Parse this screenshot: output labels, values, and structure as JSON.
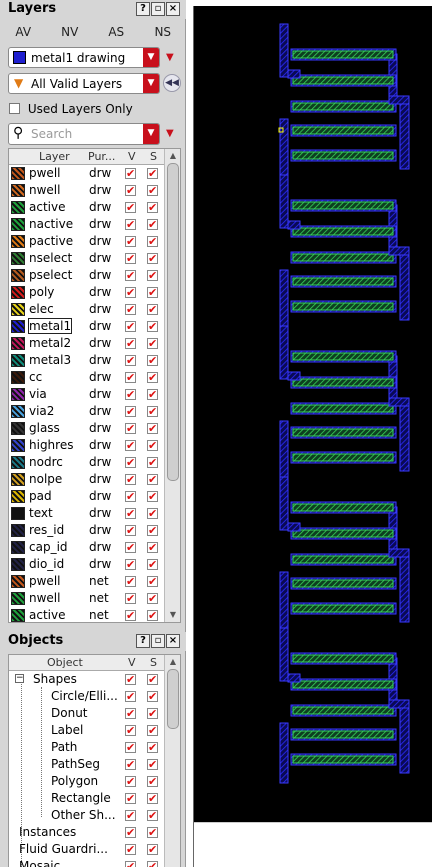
{
  "layers_panel": {
    "title": "Layers",
    "tabs": [
      "AV",
      "NV",
      "AS",
      "NS"
    ],
    "drawing_combo": "metal1 drawing",
    "filter_combo": "All Valid Layers",
    "used_only_label": "Used Layers Only",
    "search_placeholder": "Search",
    "columns": {
      "layer": "Layer",
      "purpose": "Pur...",
      "v": "V",
      "s": "S"
    },
    "rows": [
      {
        "name": "pwell",
        "purpose": "drw",
        "color": "#c4571b"
      },
      {
        "name": "nwell",
        "purpose": "drw",
        "color": "#d2691e"
      },
      {
        "name": "active",
        "purpose": "drw",
        "color": "#1fa03c"
      },
      {
        "name": "nactive",
        "purpose": "drw",
        "color": "#1fa03c"
      },
      {
        "name": "pactive",
        "purpose": "drw",
        "color": "#e07b16"
      },
      {
        "name": "nselect",
        "purpose": "drw",
        "color": "#2e7d32"
      },
      {
        "name": "pselect",
        "purpose": "drw",
        "color": "#b35a1f"
      },
      {
        "name": "poly",
        "purpose": "drw",
        "color": "#d81b1b"
      },
      {
        "name": "elec",
        "purpose": "drw",
        "color": "#e6d21a"
      },
      {
        "name": "metal1",
        "purpose": "drw",
        "color": "#1f1fcf",
        "selected": true
      },
      {
        "name": "metal2",
        "purpose": "drw",
        "color": "#c2185b"
      },
      {
        "name": "metal3",
        "purpose": "drw",
        "color": "#0f8c7a"
      },
      {
        "name": "cc",
        "purpose": "drw",
        "color": "#3a1a0a"
      },
      {
        "name": "via",
        "purpose": "drw",
        "color": "#8e24aa"
      },
      {
        "name": "via2",
        "purpose": "drw",
        "color": "#4aa3df"
      },
      {
        "name": "glass",
        "purpose": "drw",
        "color": "#333333"
      },
      {
        "name": "highres",
        "purpose": "drw",
        "color": "#3344cc"
      },
      {
        "name": "nodrc",
        "purpose": "drw",
        "color": "#1a7a8a"
      },
      {
        "name": "nolpe",
        "purpose": "drw",
        "color": "#d2a020"
      },
      {
        "name": "pad",
        "purpose": "drw",
        "color": "#d9b400"
      },
      {
        "name": "text",
        "purpose": "drw",
        "color": "#111111"
      },
      {
        "name": "res_id",
        "purpose": "drw",
        "color": "#222244"
      },
      {
        "name": "cap_id",
        "purpose": "drw",
        "color": "#222244"
      },
      {
        "name": "dio_id",
        "purpose": "drw",
        "color": "#222244"
      },
      {
        "name": "pwell",
        "purpose": "net",
        "color": "#c4571b"
      },
      {
        "name": "nwell",
        "purpose": "net",
        "color": "#1fa03c"
      },
      {
        "name": "active",
        "purpose": "net",
        "color": "#1fa03c"
      }
    ]
  },
  "objects_panel": {
    "title": "Objects",
    "columns": {
      "object": "Object",
      "v": "V",
      "s": "S"
    },
    "items": [
      {
        "name": "Shapes",
        "level": 0,
        "expander": "−"
      },
      {
        "name": "Circle/Elli...",
        "level": 2
      },
      {
        "name": "Donut",
        "level": 2
      },
      {
        "name": "Label",
        "level": 2
      },
      {
        "name": "Path",
        "level": 2
      },
      {
        "name": "PathSeg",
        "level": 2
      },
      {
        "name": "Polygon",
        "level": 2
      },
      {
        "name": "Rectangle",
        "level": 2
      },
      {
        "name": "Other Sh...",
        "level": 2
      },
      {
        "name": "Instances",
        "level": 1
      },
      {
        "name": "Fluid Guardri...",
        "level": 1
      },
      {
        "name": "Mosaic",
        "level": 1
      }
    ]
  },
  "icons": {
    "dock_restore": "restore-icon",
    "dock_close": "close-icon",
    "filter": "funnel-icon",
    "search": "magnifier-icon"
  },
  "colors": {
    "canvas_bg": "#000000",
    "metal1": "#1a1aff",
    "active": "#2ecc40",
    "check": "#dd1111"
  }
}
